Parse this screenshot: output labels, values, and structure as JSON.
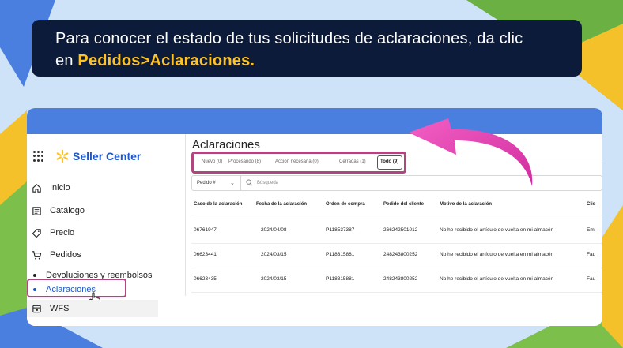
{
  "banner": {
    "text": "Para conocer el estado de tus solicitudes de aclaraciones, da clic",
    "prefix": "en ",
    "highlight": "Pedidos>Aclaraciones."
  },
  "colors": {
    "brand_blue": "#1e58c7",
    "highlight_yellow": "#ffc220",
    "callout_pink": "#b0467f",
    "banner_navy": "#0d1b3a"
  },
  "sidebar": {
    "brand": "Seller Center",
    "items": [
      {
        "label": "Inicio",
        "icon": "home-icon"
      },
      {
        "label": "Catálogo",
        "icon": "catalog-icon"
      },
      {
        "label": "Precio",
        "icon": "price-tag-icon"
      },
      {
        "label": "Pedidos",
        "icon": "cart-icon"
      }
    ],
    "subitems": [
      {
        "label": "Devoluciones y reembolsos"
      },
      {
        "label": "Aclaraciones"
      }
    ],
    "wfs": {
      "label": "WFS",
      "icon": "wfs-icon"
    }
  },
  "main": {
    "title": "Aclaraciones",
    "tabs": [
      {
        "label": "Nuevo (0)"
      },
      {
        "label": "Procesando (8)"
      },
      {
        "label": "Acción necesaria (0)"
      },
      {
        "label": "Cerradas (1)"
      },
      {
        "label": "Todo (9)"
      }
    ],
    "filter": {
      "select": "Pedido #",
      "search_placeholder": "Búsqueda"
    },
    "columns": [
      "Caso de la aclaración",
      "Fecha de la aclaración",
      "Orden de compra",
      "Pedido del cliente",
      "Motivo de la aclaración",
      "Clie"
    ],
    "rows": [
      [
        "06761947",
        "2024/04/08",
        "P118537387",
        "266242501012",
        "No he recibido el artículo de vuelta en mi almacén",
        "Emi"
      ],
      [
        "06623441",
        "2024/03/15",
        "P118315881",
        "248243800252",
        "No he recibido el artículo de vuelta en mi almacén",
        "Fau"
      ],
      [
        "06623435",
        "2024/03/15",
        "P118315881",
        "248243800252",
        "No he recibido el artículo de vuelta en mi almacén",
        "Fau"
      ]
    ]
  }
}
